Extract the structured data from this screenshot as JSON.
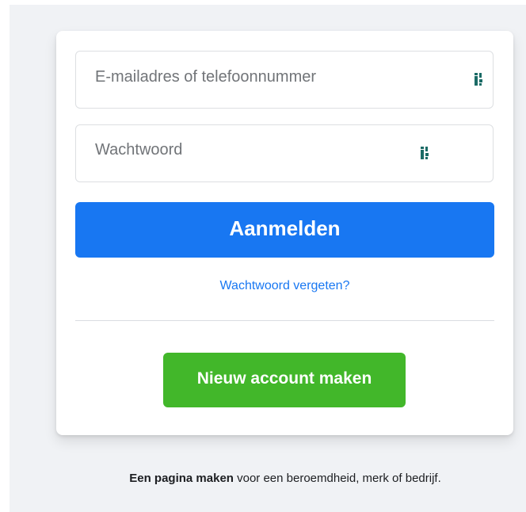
{
  "login_form": {
    "email": {
      "placeholder": "E-mailadres of telefoonnummer",
      "value": ""
    },
    "password": {
      "placeholder": "Wachtwoord",
      "value": ""
    },
    "login_label": "Aanmelden",
    "forgot_label": "Wachtwoord vergeten?",
    "create_account_label": "Nieuw account maken"
  },
  "icons": {
    "password_manager": "password-manager-icon"
  },
  "footer": {
    "create_page_link": "Een pagina maken",
    "create_page_rest": " voor een beroemdheid, merk of bedrijf."
  },
  "colors": {
    "primary_blue": "#1877f2",
    "create_green": "#42b72a",
    "page_background": "#f0f2f5",
    "icon_color": "#1b6b66"
  }
}
